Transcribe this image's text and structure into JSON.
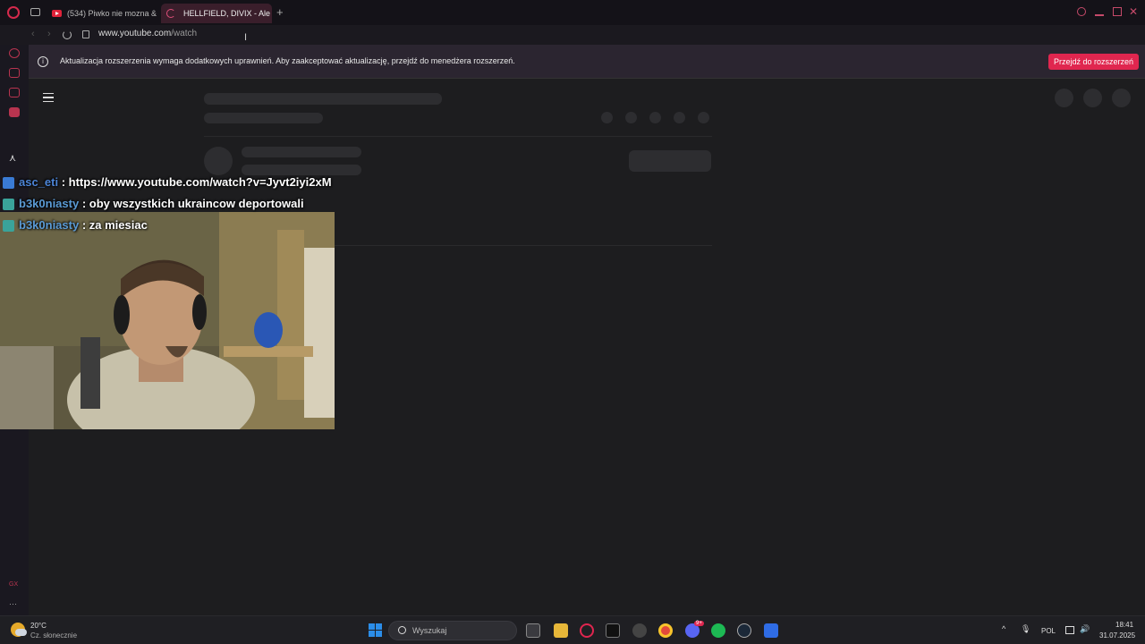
{
  "tabs": [
    {
      "title": "(534) Piwko nie mozna &",
      "active": false
    },
    {
      "title": "HELLFIELD, DIVIX - Ale A",
      "active": true
    }
  ],
  "new_tab_symbol": "+",
  "address": {
    "domain": "www.youtube.com",
    "path": "/watch"
  },
  "notice": {
    "text": "Aktualizacja rozszerzenia wymaga dodatkowych uprawnień. Aby zaakceptować aktualizację, przejdź do menedżera rozszerzeń.",
    "button": "Przejdź do rozszerzeń"
  },
  "chat": [
    {
      "user": "asc_eti",
      "separator": " : ",
      "message": "https://www.youtube.com/watch?v=Jyvt2iyi2xM"
    },
    {
      "user": "b3k0niasty",
      "separator": " : ",
      "message": "oby wszystkich ukraincow deportowali"
    },
    {
      "user": "b3k0niasty",
      "separator": " : ",
      "message": "za miesiac"
    }
  ],
  "taskbar": {
    "weather_temp": "20°C",
    "weather_cond": "Cz. słonecznie",
    "search_placeholder": "Wyszukaj",
    "language": "POL",
    "time": "18:41",
    "date": "31.07.2025",
    "discord_badge": "9+"
  },
  "colors": {
    "accent": "#e0264f",
    "chat_user": "#5b9bd5",
    "page_bg": "#1d1d1f"
  }
}
